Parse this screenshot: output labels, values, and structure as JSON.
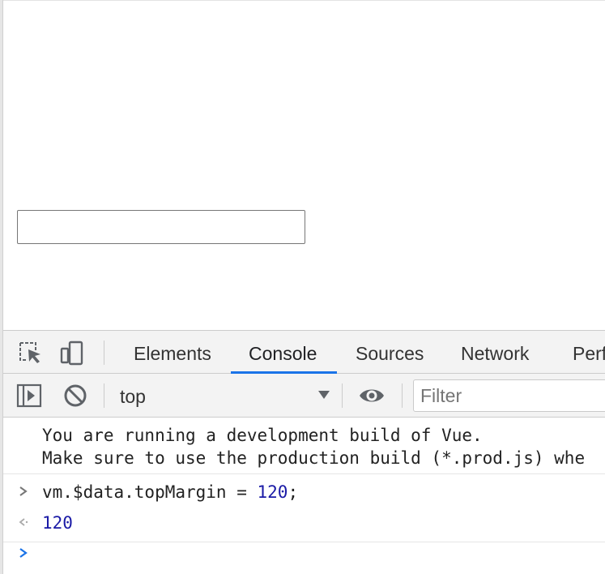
{
  "page": {
    "text_input_value": ""
  },
  "devtools": {
    "tabs": [
      "Elements",
      "Console",
      "Sources",
      "Network",
      "Perf"
    ],
    "active_tab": "Console",
    "toolbar": {
      "context": "top",
      "filter_placeholder": "Filter"
    },
    "console": {
      "message_line1": "You are running a development build of Vue.",
      "message_line2": "Make sure to use the production build (*.prod.js) whe",
      "command_prefix": "vm.$data.topMargin = ",
      "command_number": "120",
      "command_suffix": ";",
      "result": "120"
    },
    "icons": [
      "inspect-element-icon",
      "device-toolbar-icon",
      "sidebar-toggle-icon",
      "clear-console-icon",
      "live-expression-eye-icon",
      "dropdown-arrow-icon"
    ],
    "colors": {
      "accent": "#1a73e8",
      "number": "#1a1aa6",
      "prompt": "#1a73e8"
    }
  }
}
